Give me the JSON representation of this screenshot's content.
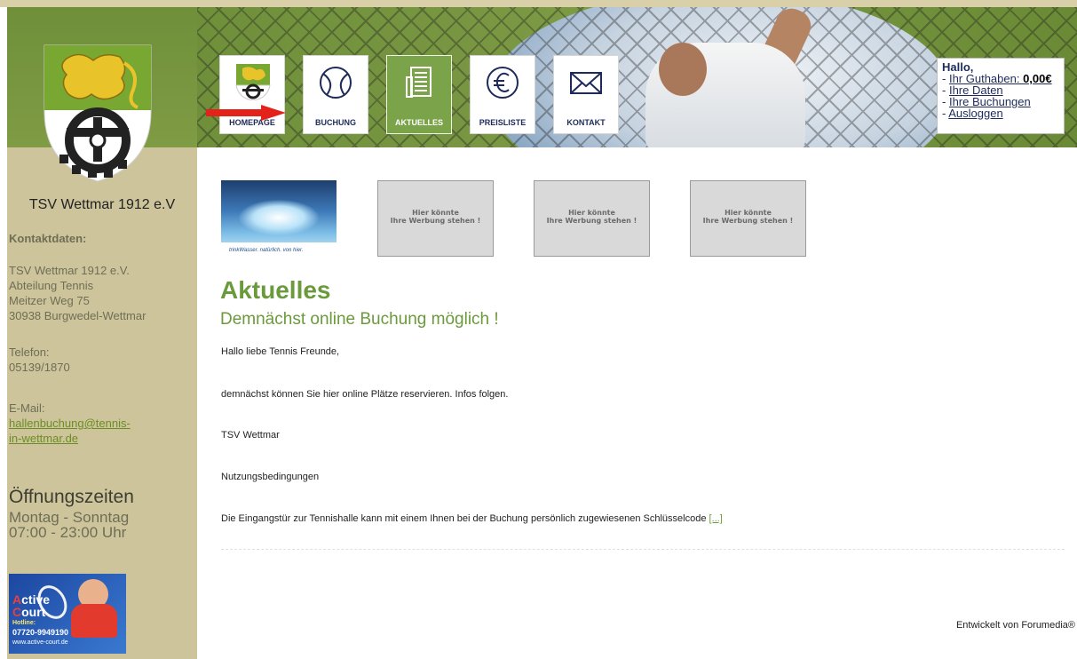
{
  "colors": {
    "accent_green": "#6b9a3c",
    "sidebar_bg": "#cdc49c",
    "nav_text": "#1e2b5a"
  },
  "sidebar": {
    "club_name": "TSV Wettmar 1912 e.V",
    "contact_heading": "Kontaktdaten:",
    "address_lines": [
      "TSV Wettmar 1912 e.V.",
      "Abteilung Tennis",
      "Meitzer Weg 75",
      "30938 Burgwedel-Wettmar"
    ],
    "phone_label": "Telefon:",
    "phone": "05139/1870",
    "email_label": "E-Mail:",
    "email_line1": "hallenbuchung@tennis-",
    "email_line2": "in-wettmar.de",
    "hours_title": "Öffnungszeiten",
    "hours_days": "Montag - Sonntag",
    "hours_time": "07:00 - 23:00 Uhr",
    "ad": {
      "brand_a": "A",
      "brand_rest": "ctive",
      "brand_c": "C",
      "brand_rest2": "ourt",
      "hotline_label": "Hotline:",
      "hotline": "07720-9949190",
      "website": "www.active-court.de"
    }
  },
  "nav": [
    {
      "label": "HOMEPAGE",
      "icon": "club-logo-icon"
    },
    {
      "label": "BUCHUNG",
      "icon": "tennis-ball-icon"
    },
    {
      "label": "AKTUELLES",
      "icon": "document-icon"
    },
    {
      "label": "PREISLISTE",
      "icon": "euro-icon"
    },
    {
      "label": "KONTAKT",
      "icon": "envelope-icon"
    }
  ],
  "user_box": {
    "greeting": "Hallo,",
    "balance_label": "Ihr Guthaben:",
    "balance_value": "0,00€",
    "my_data": "Ihre Daten",
    "my_bookings": "Ihre Buchungen",
    "logout": "Ausloggen"
  },
  "banners": {
    "water_caption": "trinkWasser. natürlich. von hier.",
    "placeholder_line1": "Hier könnte",
    "placeholder_line2": "Ihre Werbung stehen !"
  },
  "main": {
    "title": "Aktuelles",
    "subtitle": "Demnächst online Buchung möglich !",
    "paragraphs": [
      "Hallo liebe Tennis Freunde,",
      "demnächst können Sie hier online Plätze reservieren. Infos folgen.",
      "TSV Wettmar",
      "Nutzungsbedingungen",
      "Die Eingangstür zur Tennishalle kann mit einem Ihnen bei der Buchung persönlich zugewiesenen Schlüsselcode"
    ],
    "more_link": "[...]"
  },
  "footer": "Entwickelt von Forumedia®"
}
